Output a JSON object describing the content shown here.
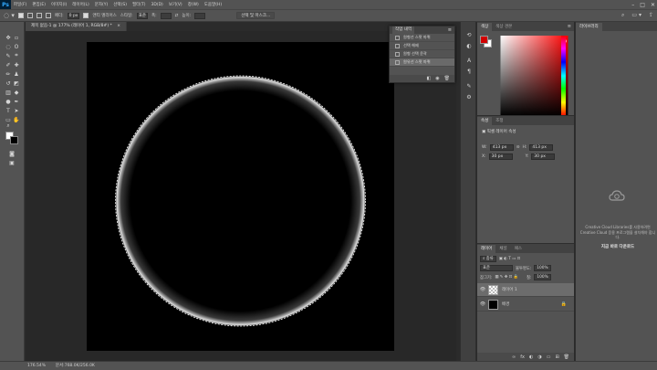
{
  "app": {
    "logo": "Ps"
  },
  "menu": [
    "파일(F)",
    "편집(E)",
    "이미지(I)",
    "레이어(L)",
    "문자(Y)",
    "선택(S)",
    "필터(T)",
    "3D(D)",
    "보기(V)",
    "창(W)",
    "도움말(H)"
  ],
  "window_controls": {
    "minimize": "–",
    "maximize": "□",
    "close": "✕"
  },
  "options_bar": {
    "blur_label": "페더:",
    "blur_value": "0 px",
    "antialias_label": "앤티 앨리어스",
    "style_label": "스타일:",
    "style_value": "표준",
    "width_label": "폭:",
    "height_label": "높이:",
    "select_mask_button": "선택 및 마스크...",
    "mode_label": "모드",
    "new_selection": "조정",
    "zoom_value": "100%"
  },
  "document": {
    "tab_title": "제목 없음-1 @ 177% (레이어 1, RGB/8#) *",
    "tab_close": "×"
  },
  "status": {
    "zoom": "176.54%",
    "doc_info": "문서:768.0K/256.0K"
  },
  "history_panel": {
    "tab": "작업 내역",
    "menu": "≡",
    "items": [
      {
        "label": "원형선 스팟 마퀴",
        "active": false
      },
      {
        "label": "선택 해제",
        "active": false
      },
      {
        "label": "원형 선택 윤곽",
        "active": false
      },
      {
        "label": "원유선 스팟 마퀴",
        "active": true
      }
    ],
    "footer_icons": [
      "◧",
      "◉",
      "🗑"
    ]
  },
  "color_panel": {
    "tabs": [
      "색상",
      "색상 견본"
    ],
    "menu": "≡",
    "fg": "#d10000",
    "bg": "#ffffff",
    "hue_color": "#ff0000"
  },
  "properties_panel": {
    "tabs": [
      "속성",
      "조정"
    ],
    "title": "픽셀 레이어 속성",
    "w_label": "W:",
    "w_value": "413 px",
    "h_label": "H:",
    "h_value": "413 px",
    "x_label": "X:",
    "x_value": "30 px",
    "y_label": "Y:",
    "y_value": "30 px",
    "link_icon": "⊝"
  },
  "layers_panel": {
    "tabs": [
      "레이어",
      "채널",
      "패스"
    ],
    "filter_label": "종류",
    "blend_mode": "표준",
    "opacity_label": "불투명도:",
    "opacity_value": "100%",
    "lock_label": "잠그기:",
    "fill_label": "칠:",
    "fill_value": "100%",
    "layers": [
      {
        "name": "레이어 1",
        "active": true,
        "thumb": "checker",
        "locked": false
      },
      {
        "name": "배경",
        "active": false,
        "thumb": "black",
        "locked": true
      }
    ],
    "footer_icons": [
      "∞",
      "fx",
      "◐",
      "◑",
      "▭",
      "⊞",
      "🗑"
    ]
  },
  "library_panel": {
    "tab": "라이브러리",
    "message": "Creative Cloud Libraries를 사용하려면 Creative Cloud 응용 프로그램을 설치해야 합니다.",
    "link": "지금 바로 다운로드"
  },
  "colors": {
    "accent": "#31a8ff",
    "panel": "#535353",
    "canvas": "#000000"
  }
}
